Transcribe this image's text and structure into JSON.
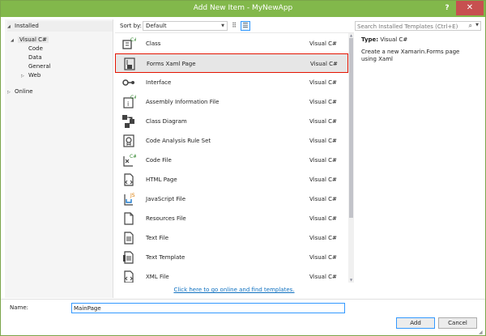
{
  "window": {
    "title": "Add New Item - MyNewApp",
    "help_label": "?",
    "close_label": "✕"
  },
  "left_panel": {
    "installed_label": "Installed",
    "visual_csharp_label": "Visual C#",
    "children": [
      "Code",
      "Data",
      "General",
      "Web"
    ],
    "online_label": "Online"
  },
  "sortbar": {
    "label": "Sort by:",
    "selected": "Default"
  },
  "search": {
    "placeholder": "Search Installed Templates (Ctrl+E)"
  },
  "templates": [
    {
      "name": "Class",
      "lang": "Visual C#",
      "icon": "class-icon"
    },
    {
      "name": "Forms Xaml Page",
      "lang": "Visual C#",
      "icon": "forms-xaml-page-icon",
      "selected": true
    },
    {
      "name": "Interface",
      "lang": "Visual C#",
      "icon": "interface-icon"
    },
    {
      "name": "Assembly Information File",
      "lang": "Visual C#",
      "icon": "assembly-info-icon"
    },
    {
      "name": "Class Diagram",
      "lang": "Visual C#",
      "icon": "class-diagram-icon"
    },
    {
      "name": "Code Analysis Rule Set",
      "lang": "Visual C#",
      "icon": "rule-set-icon"
    },
    {
      "name": "Code File",
      "lang": "Visual C#",
      "icon": "code-file-icon"
    },
    {
      "name": "HTML Page",
      "lang": "Visual C#",
      "icon": "html-page-icon"
    },
    {
      "name": "JavaScript File",
      "lang": "Visual C#",
      "icon": "javascript-file-icon"
    },
    {
      "name": "Resources File",
      "lang": "Visual C#",
      "icon": "resources-file-icon"
    },
    {
      "name": "Text File",
      "lang": "Visual C#",
      "icon": "text-file-icon"
    },
    {
      "name": "Text Template",
      "lang": "Visual C#",
      "icon": "text-template-icon"
    },
    {
      "name": "XML File",
      "lang": "Visual C#",
      "icon": "xml-file-icon"
    }
  ],
  "online_link": "Click here to go online and find templates.",
  "details": {
    "type_label": "Type:",
    "type_value": "Visual C#",
    "description": "Create a new Xamarin.Forms page using Xaml"
  },
  "bottom": {
    "name_label": "Name:",
    "name_value": "MainPage",
    "add_label": "Add",
    "cancel_label": "Cancel"
  },
  "colors": {
    "titlebar": "#82b84b",
    "close": "#c75050",
    "selection_border": "#e51400",
    "link": "#0e70c0"
  }
}
